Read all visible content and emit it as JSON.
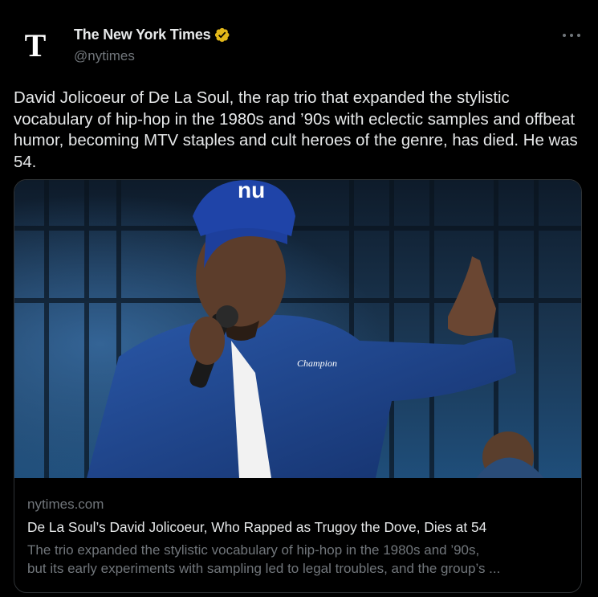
{
  "author": {
    "logo_letter": "T",
    "name": "The New York Times",
    "handle": "@nytimes",
    "verified_icon": "gold-verified-badge-icon",
    "verified_color": "#e2b719"
  },
  "more_icon": "ellipsis-icon",
  "tweet": {
    "text": "David Jolicoeur of De La Soul, the rap trio that expanded the stylistic vocabulary of hip-hop in the 1980s and ’90s with eclectic samples and offbeat humor, becoming MTV staples and cult heroes of the genre, has died. He was 54."
  },
  "card": {
    "image_caption": "nu",
    "jacket_logo": "Champion",
    "domain": "nytimes.com",
    "title": "De La Soul’s David Jolicoeur, Who Rapped as Trugoy the Dove, Dies at 54",
    "description_line1": "The trio expanded the stylistic vocabulary of hip-hop in the 1980s and ’90s,",
    "description_line2": "but its early experiments with sampling led to legal troubles, and the group’s ..."
  },
  "colors": {
    "background": "#000000",
    "text_primary": "#e7e9ea",
    "text_secondary": "#71767b",
    "border": "#2f3336"
  }
}
